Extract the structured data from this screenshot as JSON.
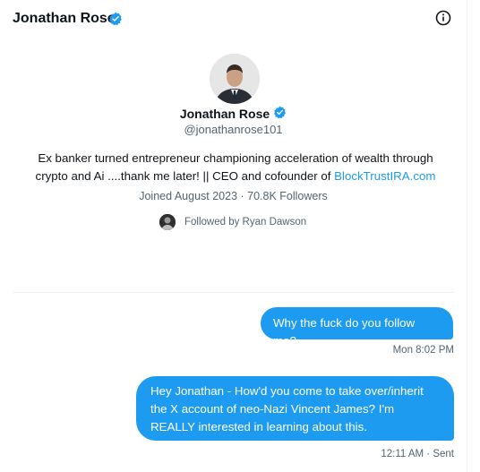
{
  "header": {
    "name": "Jonathan Rose",
    "info_icon": "info-circle-icon"
  },
  "profile": {
    "name": "Jonathan Rose",
    "handle": "@jonathanrose101",
    "bio_text": "Ex banker turned entrepreneur championing acceleration of wealth through crypto and Ai ....thank me later! || CEO and cofounder of ",
    "bio_link": "BlockTrustIRA.com",
    "joined": "Joined August 2023 · 70.8K Followers",
    "followed_by": "Followed by Ryan Dawson"
  },
  "messages": [
    {
      "text": "Why the fuck do you follow me?",
      "meta": "Mon 8:02 PM"
    },
    {
      "text": "Hey Jonathan - How'd you come to take over/inherit the X account of neo-Nazi Vincent James? I'm REALLY interested in learning about this.",
      "meta": "12:11 AM · Sent"
    }
  ],
  "colors": {
    "accent": "#1d9bf0",
    "text_primary": "#0f1419",
    "text_secondary": "#536471"
  }
}
